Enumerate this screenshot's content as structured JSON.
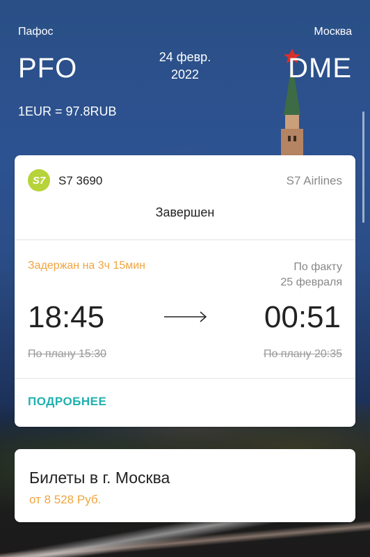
{
  "header": {
    "from_city": "Пафос",
    "to_city": "Москва",
    "from_code": "PFO",
    "to_code": "DME",
    "date_line1": "24 февр.",
    "date_line2": "2022",
    "exchange_rate": "1EUR = 97.8RUB"
  },
  "flight": {
    "airline_logo_text": "S7",
    "flight_number": "S7 3690",
    "airline": "S7 Airlines",
    "status": "Завершен",
    "delay_text": "Задержан на 3ч 15мин",
    "actual_label": "По факту",
    "actual_date": "25 февраля",
    "departure_time": "18:45",
    "arrival_time": "00:51",
    "planned_departure": "По плану 15:30",
    "planned_arrival": "По плану 20:35",
    "more_button": "ПОДРОБНЕЕ"
  },
  "tickets": {
    "title": "Билеты в г. Москва",
    "price": "от 8 528 Руб."
  },
  "colors": {
    "accent_orange": "#f0a540",
    "accent_teal": "#1fb0b0",
    "s7_green": "#b6d33a"
  },
  "icons": [
    "arrow-right-icon",
    "s7-logo"
  ]
}
